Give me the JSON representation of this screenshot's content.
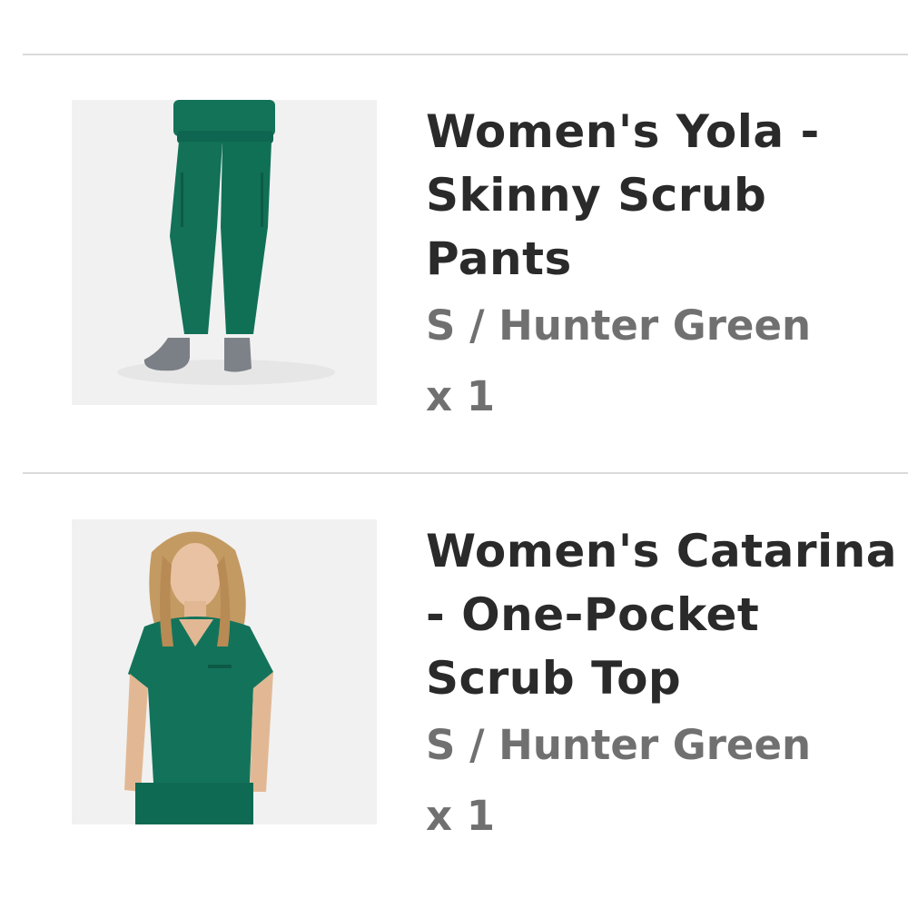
{
  "cart": {
    "items": [
      {
        "title": "Women's Yola - Skinny Scrub Pants",
        "variant": "S / Hunter Green",
        "quantity": "x 1",
        "image": "scrub-pants-photo",
        "product_color": "#0f6e55"
      },
      {
        "title": "Women's Catarina - One-Pocket Scrub Top",
        "variant": "S / Hunter Green",
        "quantity": "x 1",
        "image": "scrub-top-photo",
        "product_color": "#0f6e55"
      }
    ]
  }
}
